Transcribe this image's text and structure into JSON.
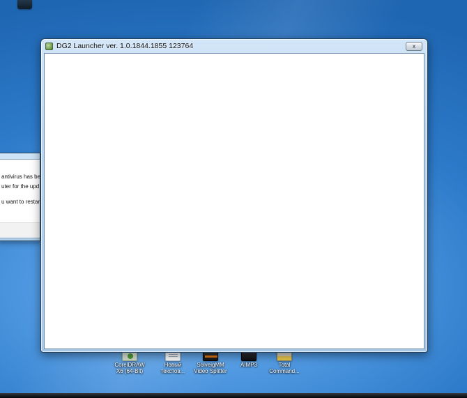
{
  "window": {
    "title": "DG2 Launcher ver. 1.0.1844.1855 123764",
    "close_label": "x"
  },
  "background_dialog": {
    "line1": "antivirus has be",
    "line2": "uter for the upd",
    "line3": "u want to restar"
  },
  "desktop_icons": [
    {
      "line1": "CorelDRAW",
      "line2": "X6 (64-Bit)"
    },
    {
      "line1": "Новый",
      "line2": "текстов..."
    },
    {
      "line1": "SolveigMM",
      "line2": "Video Splitter"
    },
    {
      "line1": "AIMP3",
      "line2": ""
    },
    {
      "line1": "Total",
      "line2": "Command..."
    }
  ],
  "colors": {
    "desktop_glow": "#7cb9f0",
    "desktop_edge": "#1f66b2",
    "titlebar": "#cde4f7",
    "taskbar": "#0b0e12"
  }
}
